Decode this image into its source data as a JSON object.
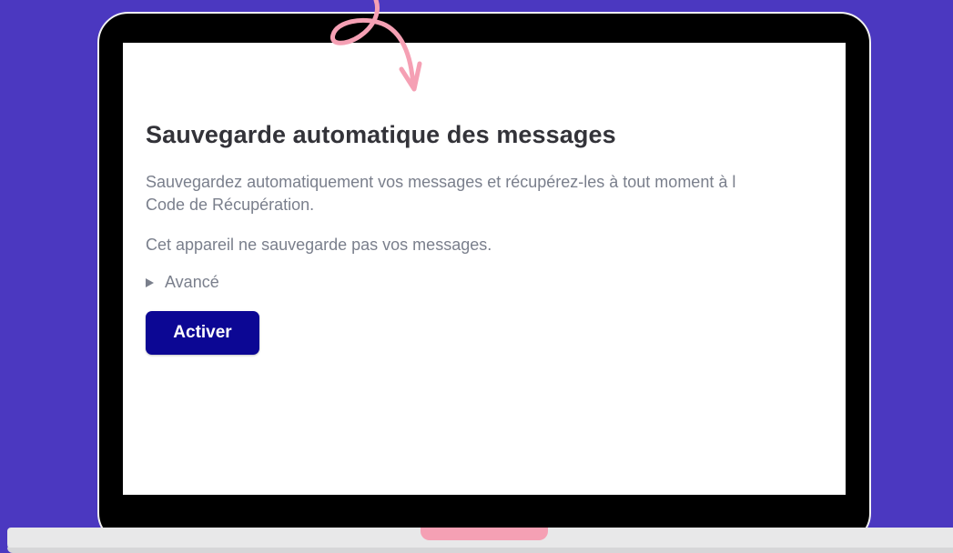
{
  "colors": {
    "background": "#4b38c0",
    "button": "#0c0794",
    "accent": "#f5a0b4"
  },
  "dialog": {
    "title": "Sauvegarde automatique des messages",
    "description": "Sauvegardez automatiquement vos messages et récupérez-les à tout moment à l\nCode de Récupération.",
    "status": "Cet appareil ne sauvegarde pas vos messages.",
    "advanced_label": "Avancé",
    "advanced_icon": "triangle-right-icon",
    "activate_label": "Activer"
  },
  "decoration": {
    "arrow_icon": "curly-arrow-icon"
  }
}
